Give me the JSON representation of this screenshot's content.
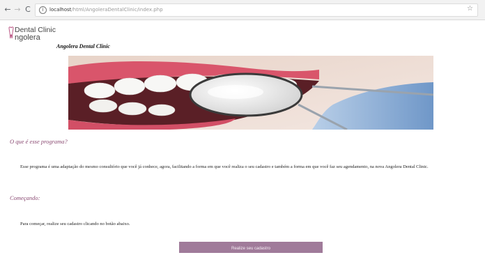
{
  "browser": {
    "url_host": "localhost",
    "url_path": "/html/AngoleraDentalClinic/index.php"
  },
  "logo": {
    "line1": "Dental Clinic",
    "line2": "ngolera"
  },
  "site": {
    "clinic_name": "Angolera Dental Clinic"
  },
  "sections": {
    "about_heading": "O que é esse programa?",
    "about_text": "Esse programa é uma adaptação do mesmo consultório que você já conhece, agora, facilitando a forma em que você realiza o seu cadastro e também a forma em que você faz seu agendamento, na nova Angolera Dental Clinic.",
    "start_heading": "Começando:",
    "start_text": "Para começar, realize seu cadastro clicando no botão abaixo."
  },
  "actions": {
    "register_label": "Realize seu cadastro"
  },
  "colors": {
    "accent": "#8a4a72",
    "button": "#a07b9a"
  }
}
